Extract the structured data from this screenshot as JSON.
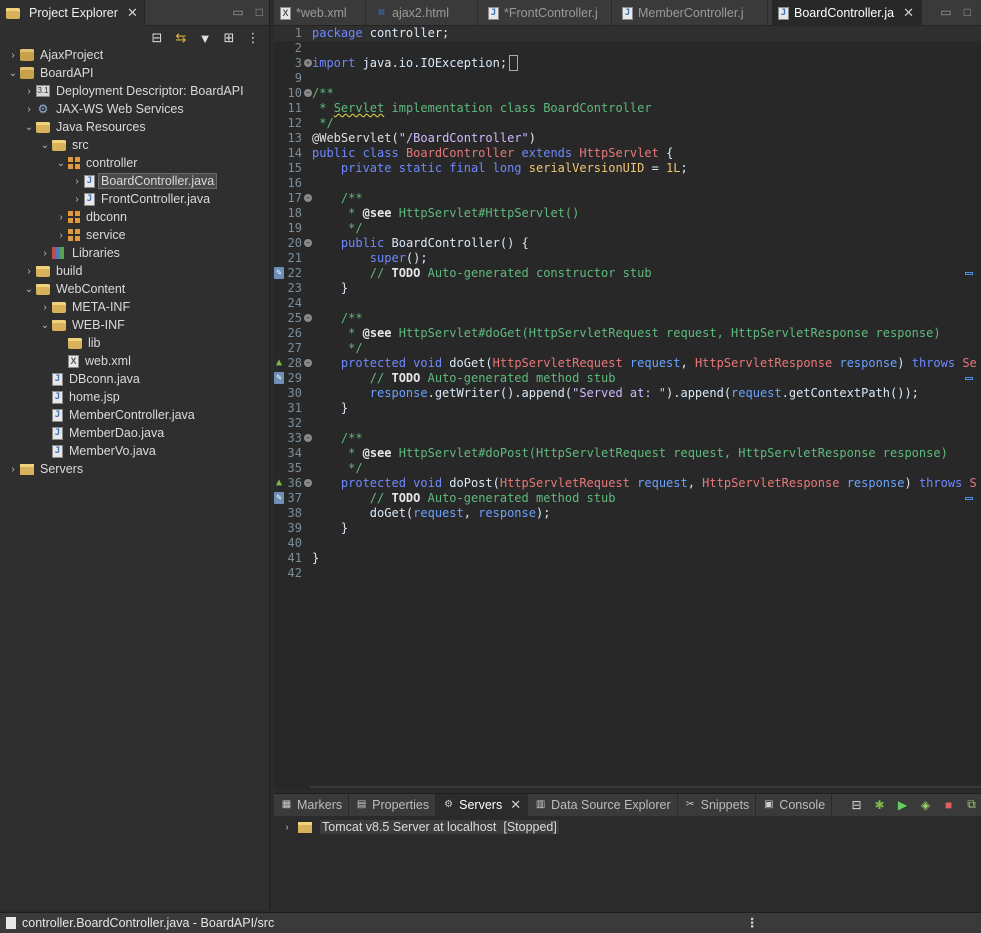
{
  "explorer": {
    "title": "Project Explorer",
    "toolbar": [
      "collapse-all-icon",
      "link-editor-icon",
      "filter-icon",
      "view-menu-icon",
      "more-icon"
    ],
    "tree": [
      {
        "label": "AjaxProject",
        "depth": 0,
        "arrow": "›",
        "icon": "project"
      },
      {
        "label": "BoardAPI",
        "depth": 0,
        "arrow": "⌄",
        "icon": "project"
      },
      {
        "label": "Deployment Descriptor: BoardAPI",
        "depth": 1,
        "arrow": "›",
        "icon": "dd"
      },
      {
        "label": "JAX-WS Web Services",
        "depth": 1,
        "arrow": "›",
        "icon": "ws"
      },
      {
        "label": "Java Resources",
        "depth": 1,
        "arrow": "⌄",
        "icon": "folder"
      },
      {
        "label": "src",
        "depth": 2,
        "arrow": "⌄",
        "icon": "folder"
      },
      {
        "label": "controller",
        "depth": 3,
        "arrow": "⌄",
        "icon": "package"
      },
      {
        "label": "BoardController.java",
        "depth": 4,
        "arrow": "›",
        "icon": "java",
        "selected": true
      },
      {
        "label": "FrontController.java",
        "depth": 4,
        "arrow": "›",
        "icon": "java"
      },
      {
        "label": "dbconn",
        "depth": 3,
        "arrow": "›",
        "icon": "package"
      },
      {
        "label": "service",
        "depth": 3,
        "arrow": "›",
        "icon": "package"
      },
      {
        "label": "Libraries",
        "depth": 2,
        "arrow": "›",
        "icon": "lib"
      },
      {
        "label": "build",
        "depth": 1,
        "arrow": "›",
        "icon": "folder"
      },
      {
        "label": "WebContent",
        "depth": 1,
        "arrow": "⌄",
        "icon": "folder"
      },
      {
        "label": "META-INF",
        "depth": 2,
        "arrow": "›",
        "icon": "folder"
      },
      {
        "label": "WEB-INF",
        "depth": 2,
        "arrow": "⌄",
        "icon": "folder"
      },
      {
        "label": "lib",
        "depth": 3,
        "arrow": "",
        "icon": "folder"
      },
      {
        "label": "web.xml",
        "depth": 3,
        "arrow": "",
        "icon": "xml"
      },
      {
        "label": "DBconn.java",
        "depth": 2,
        "arrow": "",
        "icon": "java"
      },
      {
        "label": "home.jsp",
        "depth": 2,
        "arrow": "",
        "icon": "java"
      },
      {
        "label": "MemberController.java",
        "depth": 2,
        "arrow": "",
        "icon": "java"
      },
      {
        "label": "MemberDao.java",
        "depth": 2,
        "arrow": "",
        "icon": "java"
      },
      {
        "label": "MemberVo.java",
        "depth": 2,
        "arrow": "",
        "icon": "java"
      },
      {
        "label": "Servers",
        "depth": 0,
        "arrow": "›",
        "icon": "server"
      }
    ]
  },
  "editor": {
    "tabs": [
      {
        "label": "*web.xml",
        "icon": "xml",
        "active": false
      },
      {
        "label": "ajax2.html",
        "icon": "html",
        "active": false
      },
      {
        "label": "*FrontController.j",
        "icon": "java",
        "active": false
      },
      {
        "label": "MemberController.j",
        "icon": "java",
        "active": false
      },
      {
        "label": "BoardController.ja",
        "icon": "java",
        "active": true
      }
    ],
    "lines": [
      {
        "n": "1",
        "html": "<span class='kw'>package</span> controller;",
        "current": true
      },
      {
        "n": "2",
        "html": ""
      },
      {
        "n": "3",
        "fold": "+",
        "html": "<span class='kw'>import</span> java.io.IOException;<span style='border:1px solid #aaa;margin-left:2px'> </span>"
      },
      {
        "n": "9",
        "html": ""
      },
      {
        "n": "10",
        "fold": "−",
        "html": "<span class='cm'>/**</span>"
      },
      {
        "n": "11",
        "html": "<span class='cm'> * <u style='text-decoration:underline wavy #c0c040'>Servlet</u> implementation class BoardController</span>"
      },
      {
        "n": "12",
        "html": "<span class='cm'> */</span>"
      },
      {
        "n": "13",
        "html": "<span class='ann'>@WebServlet</span>(<span class='str'>\"/BoardController\"</span>)"
      },
      {
        "n": "14",
        "html": "<span class='kw'>public class</span> <span class='cls'>BoardController</span> <span class='kw'>extends</span> <span class='cls'>HttpServlet</span> {"
      },
      {
        "n": "15",
        "html": "    <span class='kw'>private static final long</span> <span class='fn' style='color:#f0c674'>serialVersionUID</span> = <span class='str' style='color:#f0c674'>1L</span>;"
      },
      {
        "n": "16",
        "html": ""
      },
      {
        "n": "17",
        "fold": "−",
        "html": "    <span class='cm'>/**</span>"
      },
      {
        "n": "18",
        "html": "    <span class='cm'> * <span class='tag'>@see</span> HttpServlet#HttpServlet()</span>"
      },
      {
        "n": "19",
        "html": "    <span class='cm'> */</span>"
      },
      {
        "n": "20",
        "fold": "−",
        "html": "    <span class='kw'>public</span> BoardController() {"
      },
      {
        "n": "21",
        "html": "        <span class='kw'>super</span>();"
      },
      {
        "n": "22",
        "marker": "task",
        "overview": true,
        "html": "        <span class='cm'>// <span class='tag'>TODO</span> Auto-generated constructor stub</span>"
      },
      {
        "n": "23",
        "html": "    }"
      },
      {
        "n": "24",
        "html": ""
      },
      {
        "n": "25",
        "fold": "−",
        "html": "    <span class='cm'>/**</span>"
      },
      {
        "n": "26",
        "html": "    <span class='cm'> * <span class='tag'>@see</span> HttpServlet#doGet(HttpServletRequest request, HttpServletResponse response)</span>"
      },
      {
        "n": "27",
        "html": "    <span class='cm'> */</span>"
      },
      {
        "n": "28",
        "fold": "−",
        "marker": "override",
        "html": "    <span class='kw'>protected void</span> doGet(<span class='cls'>HttpServletRequest</span> <span class='var'>request</span>, <span class='cls'>HttpServletResponse</span> <span class='var'>response</span>) <span class='kw'>throws</span> <span class='cls'>Se</span>"
      },
      {
        "n": "29",
        "marker": "task",
        "overview": true,
        "html": "        <span class='cm'>// <span class='tag'>TODO</span> Auto-generated method stub</span>"
      },
      {
        "n": "30",
        "html": "        <span class='var'>response</span>.getWriter().append(<span class='str'>\"Served at: \"</span>).append(<span class='var'>request</span>.getContextPath());"
      },
      {
        "n": "31",
        "html": "    }"
      },
      {
        "n": "32",
        "html": ""
      },
      {
        "n": "33",
        "fold": "−",
        "html": "    <span class='cm'>/**</span>"
      },
      {
        "n": "34",
        "html": "    <span class='cm'> * <span class='tag'>@see</span> HttpServlet#doPost(HttpServletRequest request, HttpServletResponse response)</span>"
      },
      {
        "n": "35",
        "html": "    <span class='cm'> */</span>"
      },
      {
        "n": "36",
        "fold": "−",
        "marker": "override",
        "html": "    <span class='kw'>protected void</span> doPost(<span class='cls'>HttpServletRequest</span> <span class='var'>request</span>, <span class='cls'>HttpServletResponse</span> <span class='var'>response</span>) <span class='kw'>throws</span> <span class='cls'>S</span>"
      },
      {
        "n": "37",
        "marker": "task",
        "overview": true,
        "html": "        <span class='cm'>// <span class='tag'>TODO</span> Auto-generated method stub</span>"
      },
      {
        "n": "38",
        "html": "        doGet(<span class='var'>request</span>, <span class='var'>response</span>);"
      },
      {
        "n": "39",
        "html": "    }"
      },
      {
        "n": "40",
        "html": ""
      },
      {
        "n": "41",
        "html": "}"
      },
      {
        "n": "42",
        "html": ""
      }
    ]
  },
  "panel": {
    "tabs": [
      {
        "label": "Markers",
        "icon": "markers-icon",
        "active": false
      },
      {
        "label": "Properties",
        "icon": "properties-icon",
        "active": false
      },
      {
        "label": "Servers",
        "icon": "servers-icon",
        "active": true,
        "closable": true
      },
      {
        "label": "Data Source Explorer",
        "icon": "data-source-icon",
        "active": false
      },
      {
        "label": "Snippets",
        "icon": "snippets-icon",
        "active": false
      },
      {
        "label": "Console",
        "icon": "console-icon",
        "active": false
      }
    ],
    "server": {
      "label": "Tomcat v8.5 Server at localhost",
      "state": "[Stopped]"
    }
  },
  "status": {
    "text": "controller.BoardController.java - BoardAPI/src"
  }
}
